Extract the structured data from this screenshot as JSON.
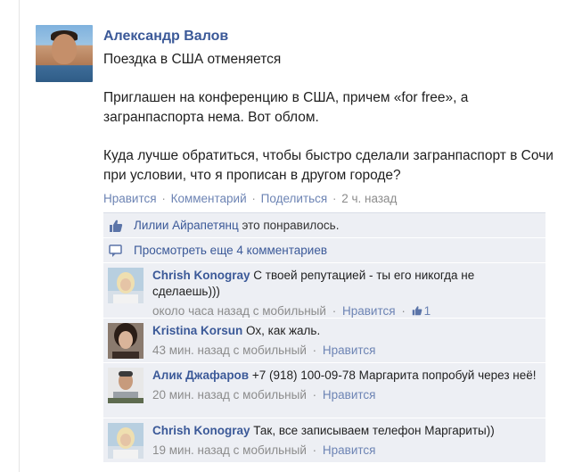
{
  "post": {
    "author": "Александр Валов",
    "title": "Поездка в США отменяется",
    "paragraph1": "Приглашен на конференцию в США, причем «for free», а загранпаспорта нема. Вот облом.",
    "paragraph2": "Куда лучше обратиться, чтобы быстро сделали загранпаспорт в Сочи при условии, что я прописан в другом городе?",
    "actions": {
      "like": "Нравится",
      "comment": "Комментарий",
      "share": "Поделиться",
      "time": "2 ч. назад",
      "separator": "·"
    }
  },
  "likes": {
    "name": "Лилии Айрапетянц",
    "suffix": " это понравилось."
  },
  "more_comments": "Просмотреть еще 4 комментариев",
  "comments": [
    {
      "author": "Chrish Konogray",
      "text": "С твоей репутацией - ты его никогда не сделаешь)))",
      "meta": "около часа назад с мобильный",
      "like": "Нравится",
      "likes_count": "1"
    },
    {
      "author": "Kristina Korsun",
      "text": "Ох, как жаль.",
      "meta": "43 мин. назад с мобильный",
      "like": "Нравится"
    },
    {
      "author": "Алик Джафаров",
      "text": "+7 (918) 100-09-78 Маргарита попробуй через неё!",
      "meta": "20 мин. назад с мобильный",
      "like": "Нравится"
    },
    {
      "author": "Chrish Konogray",
      "text": "Так, все записываем телефон Маргариты))",
      "meta": "19 мин. назад с мобильный",
      "like": "Нравится"
    }
  ],
  "colors": {
    "link": "#3b5998",
    "meta_link": "#6d84b4",
    "comment_bg": "#edeff4"
  }
}
